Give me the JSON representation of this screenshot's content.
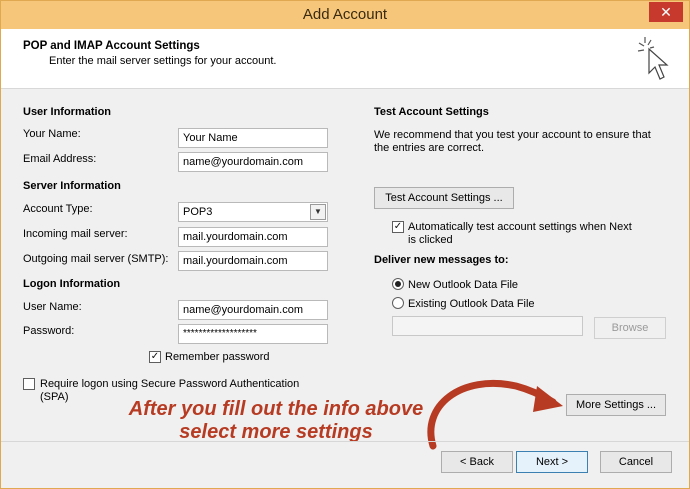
{
  "window": {
    "title": "Add Account",
    "close_glyph": "✕"
  },
  "header": {
    "title": "POP and IMAP Account Settings",
    "subtitle": "Enter the mail server settings for your account."
  },
  "user_info": {
    "heading": "User Information",
    "name_label": "Your Name:",
    "name_value": "Your Name",
    "email_label": "Email Address:",
    "email_value": "name@yourdomain.com"
  },
  "server_info": {
    "heading": "Server Information",
    "account_type_label": "Account Type:",
    "account_type_value": "POP3",
    "incoming_label": "Incoming mail server:",
    "incoming_value": "mail.yourdomain.com",
    "outgoing_label": "Outgoing mail server (SMTP):",
    "outgoing_value": "mail.yourdomain.com"
  },
  "logon_info": {
    "heading": "Logon Information",
    "username_label": "User Name:",
    "username_value": "name@yourdomain.com",
    "password_label": "Password:",
    "password_value": "*******************",
    "remember_label": "Remember password",
    "remember_checked": true,
    "spa_label_line1": "Require logon using Secure Password Authentication",
    "spa_label_line2": "(SPA)",
    "spa_checked": false
  },
  "test_settings": {
    "heading": "Test Account Settings",
    "description_line1": "We recommend that you test your account to ensure that",
    "description_line2": "the entries are correct.",
    "test_button": "Test Account Settings ...",
    "auto_test_line1": "Automatically test account settings when Next",
    "auto_test_line2": "is clicked",
    "auto_test_checked": true
  },
  "deliver": {
    "heading": "Deliver new messages to:",
    "option_new": "New Outlook Data File",
    "option_existing": "Existing Outlook Data File",
    "selected": "new",
    "existing_path": "",
    "browse_button": "Browse"
  },
  "more_settings_button": "More Settings ...",
  "annotation": {
    "line1": "After you fill out the info above",
    "line2": "select more settings",
    "color": "#b73b22"
  },
  "footer": {
    "back_button": "< Back",
    "next_button": "Next >",
    "cancel_button": "Cancel"
  },
  "icons": {
    "wizard": "wand-cursor-icon",
    "check": "✓",
    "dropdown": "▼"
  }
}
